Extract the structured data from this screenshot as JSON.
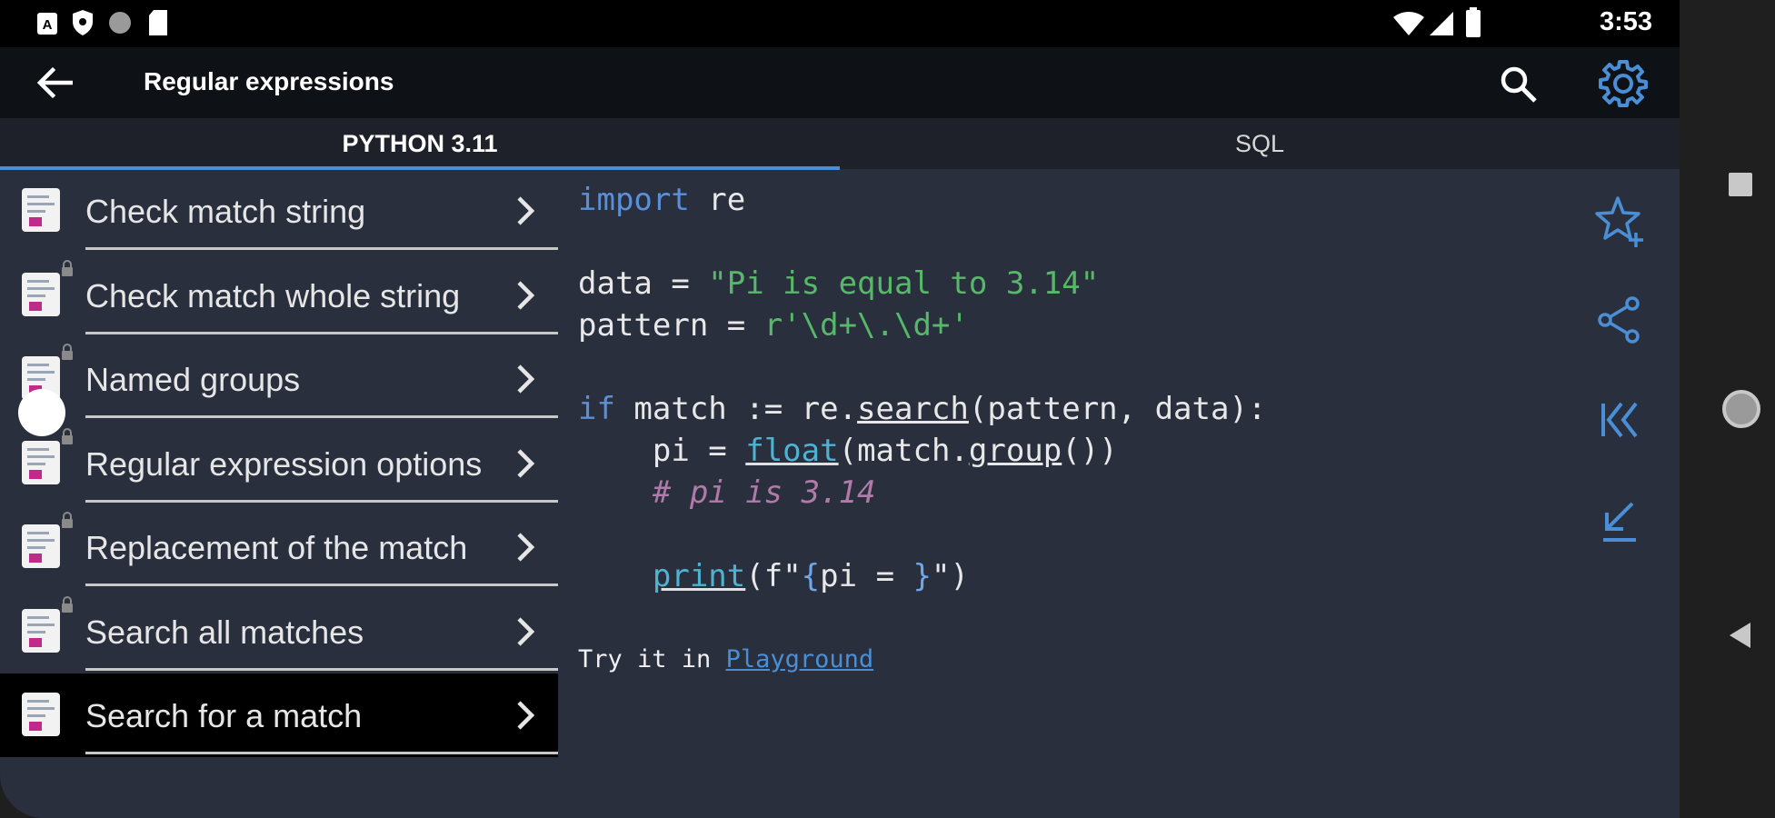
{
  "status_bar": {
    "time": "3:53"
  },
  "app_bar": {
    "title": "Regular expressions"
  },
  "tabs": [
    {
      "label": "PYTHON 3.11",
      "active": true
    },
    {
      "label": "SQL",
      "active": false
    }
  ],
  "list": {
    "items": [
      {
        "label": "Check match string",
        "locked": false,
        "selected": false
      },
      {
        "label": "Check match whole string",
        "locked": true,
        "selected": false
      },
      {
        "label": "Named groups",
        "locked": true,
        "selected": false
      },
      {
        "label": "Regular expression options",
        "locked": true,
        "selected": false
      },
      {
        "label": "Replacement of the match",
        "locked": true,
        "selected": false
      },
      {
        "label": "Search all matches",
        "locked": true,
        "selected": false
      },
      {
        "label": "Search for a match",
        "locked": false,
        "selected": true
      }
    ]
  },
  "code": {
    "l1_kw": "import",
    "l1_rest": " re",
    "l2_a": "data = ",
    "l2_str": "\"Pi is equal to 3.14\"",
    "l3_a": "pattern = ",
    "l3_str": "r'\\d+\\.\\d+'",
    "l4_kw": "if",
    "l4_a": " match := re.",
    "l4_fn": "search",
    "l4_b": "(pattern, data):",
    "l5_a": "    pi = ",
    "l5_fn": "float",
    "l5_b": "(match.",
    "l5_fn2": "group",
    "l5_c": "())",
    "l6_cm": "    # pi is 3.14",
    "l7_indent": "    ",
    "l7_fn": "print",
    "l7_b": "(f\"",
    "l7_brace1": "{",
    "l7_c": "pi = ",
    "l7_brace2": "}",
    "l7_d": "\")"
  },
  "try_it": {
    "prefix": "Try it in ",
    "link": "Playground"
  },
  "icons": {
    "back": "back-arrow-icon",
    "search": "search-icon",
    "settings": "gear-icon",
    "favorite": "star-plus-icon",
    "share": "share-icon",
    "first": "skip-to-first-icon",
    "collapse": "collapse-arrow-icon"
  },
  "colors": {
    "accent": "#4a8fd6",
    "background": "#2a2f3e",
    "keyword": "#5b8fd6",
    "string": "#58b86a",
    "comment": "#b07ba8"
  }
}
